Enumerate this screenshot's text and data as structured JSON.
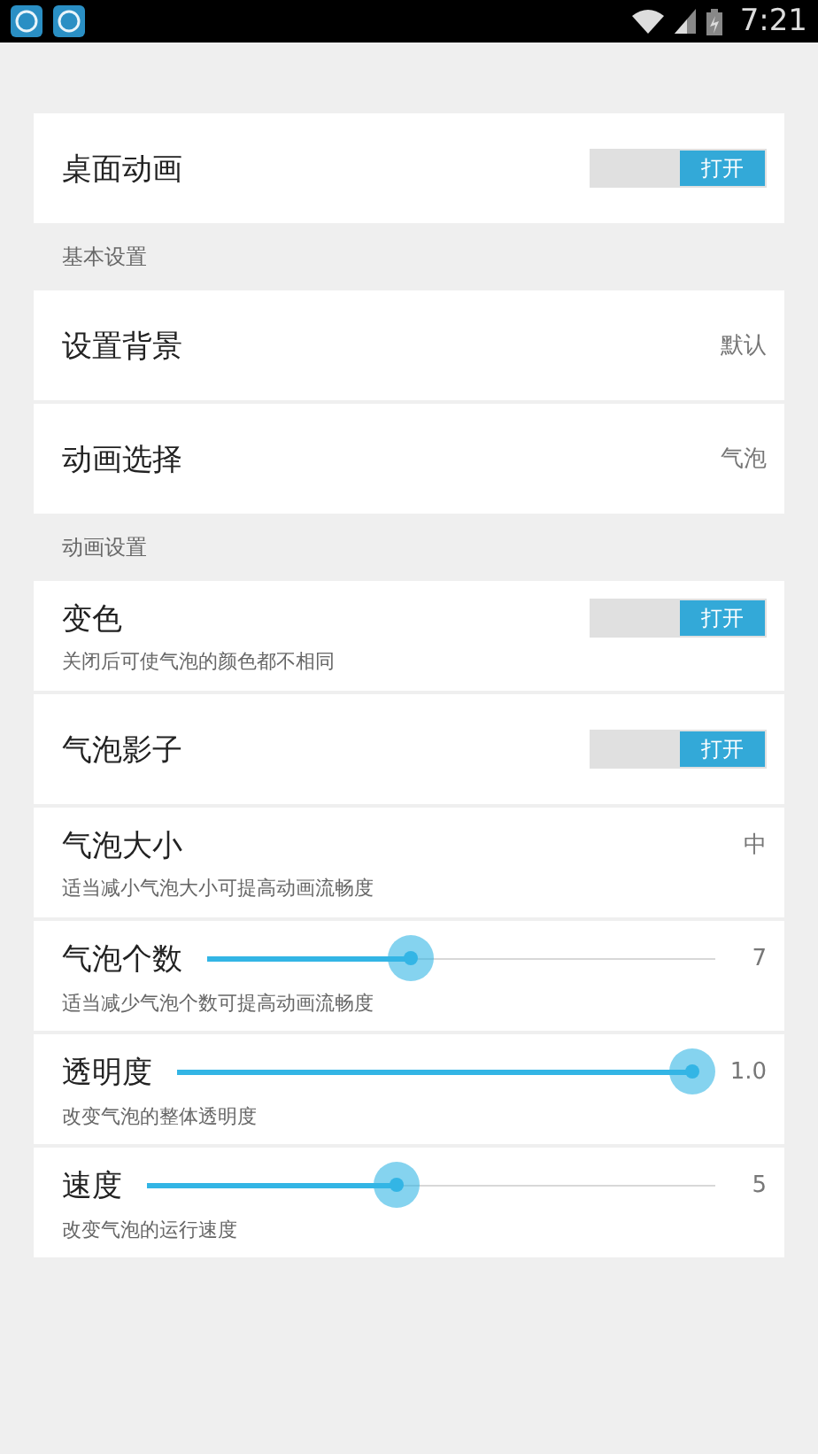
{
  "status_bar": {
    "time": "7:21"
  },
  "sections": [
    {
      "rows": [
        {
          "kind": "toggle",
          "title": "桌面动画",
          "on": true,
          "switch_label": "打开"
        }
      ]
    },
    {
      "header": "基本设置",
      "rows": [
        {
          "kind": "value",
          "title": "设置背景",
          "value": "默认"
        },
        {
          "kind": "value",
          "title": "动画选择",
          "value": "气泡"
        }
      ]
    },
    {
      "header": "动画设置",
      "rows": [
        {
          "kind": "toggle",
          "title": "变色",
          "subtitle": "关闭后可使气泡的颜色都不相同",
          "on": true,
          "switch_label": "打开"
        },
        {
          "kind": "toggle",
          "title": "气泡影子",
          "on": true,
          "switch_label": "打开"
        },
        {
          "kind": "value",
          "title": "气泡大小",
          "subtitle": "适当减小气泡大小可提高动画流畅度",
          "value": "中"
        },
        {
          "kind": "slider",
          "title": "气泡个数",
          "subtitle": "适当减少气泡个数可提高动画流畅度",
          "level": 0.4,
          "value": "7"
        },
        {
          "kind": "slider",
          "title": "透明度",
          "subtitle": "改变气泡的整体透明度",
          "level": 1.0,
          "value": "1.0"
        },
        {
          "kind": "slider",
          "title": "速度",
          "subtitle": "改变气泡的运行速度",
          "level": 0.44,
          "value": "5"
        }
      ]
    }
  ]
}
